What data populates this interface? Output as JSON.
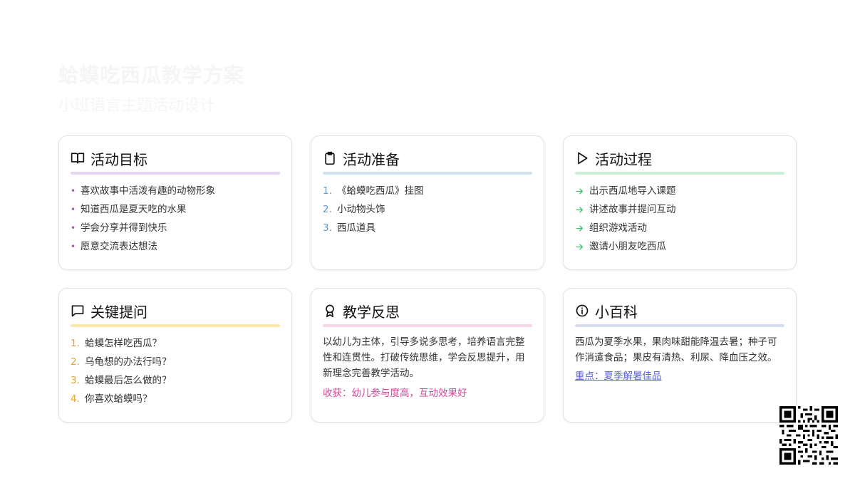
{
  "header": {
    "title": "蛤蟆吃西瓜教学方案",
    "subtitle": "小班语言主题活动设计"
  },
  "cards": {
    "goals": {
      "title": "活动目标",
      "icon": "book-icon",
      "bar_color": "#e6d4f5",
      "accent": "#9b59d0",
      "items": [
        "喜欢故事中活泼有趣的动物形象",
        "知道西瓜是夏天吃的水果",
        "学会分享并得到快乐",
        "愿意交流表达想法"
      ]
    },
    "prep": {
      "title": "活动准备",
      "icon": "clipboard-icon",
      "bar_color": "#cfe3f5",
      "accent": "#5b9bd5",
      "items": [
        "《蛤蟆吃西瓜》挂图",
        "小动物头饰",
        "西瓜道具"
      ],
      "numbers": [
        "1.",
        "2.",
        "3."
      ]
    },
    "process": {
      "title": "活动过程",
      "icon": "play-icon",
      "bar_color": "#c9f0d6",
      "accent": "#3cc66a",
      "items": [
        "出示西瓜地导入课题",
        "讲述故事并提问互动",
        "组织游戏活动",
        "邀请小朋友吃西瓜"
      ]
    },
    "questions": {
      "title": "关键提问",
      "icon": "message-icon",
      "bar_color": "#fbe8a6",
      "accent": "#e0a52a",
      "items": [
        "蛤蟆怎样吃西瓜？",
        "乌龟想的办法行吗？",
        "蛤蟆最后怎么做的？",
        "你喜欢蛤蟆吗？"
      ],
      "numbers": [
        "1.",
        "2.",
        "3.",
        "4."
      ]
    },
    "reflection": {
      "title": "教学反思",
      "icon": "award-icon",
      "bar_color": "#f8d3e6",
      "accent": "#d6459a",
      "paragraph": "以幼儿为主体，引导多说多思考，培养语言完整性和连贯性。打破传统思维，学会反思提升，用新理念完善教学活动。",
      "highlight": "收获：幼儿参与度高，互动效果好"
    },
    "wiki": {
      "title": "小百科",
      "icon": "info-icon",
      "bar_color": "#d6dcf0",
      "accent": "#5b63d8",
      "paragraph": "西瓜为夏季水果，果肉味甜能降温去暑；种子可作消遣食品；果皮有清热、利尿、降血压之效。",
      "link": "重点：夏季解暑佳品"
    }
  }
}
